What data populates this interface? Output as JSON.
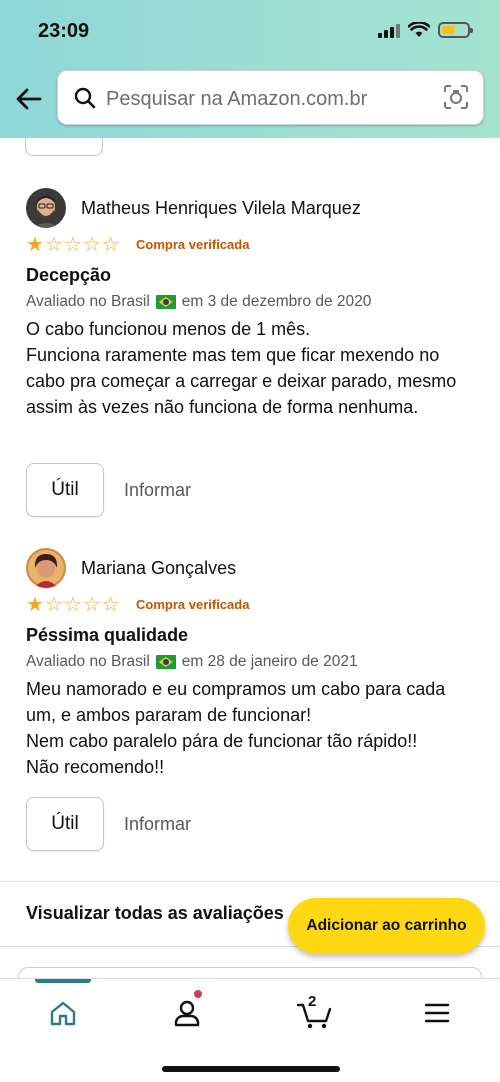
{
  "status": {
    "time": "23:09"
  },
  "search": {
    "placeholder": "Pesquisar na Amazon.com.br"
  },
  "reviews": [
    {
      "author": "Matheus Henriques Vilela Marquez",
      "rating": 1,
      "rating_max": 5,
      "verified": "Compra verificada",
      "title": "Decepção",
      "meta_prefix": "Avaliado no Brasil",
      "meta_date": "em 3 de dezembro de 2020",
      "body": "O cabo funcionou menos de 1 mês.\nFunciona raramente mas tem que ficar mexendo no cabo pra começar a carregar e deixar parado, mesmo assim às vezes não funciona de forma nenhuma.",
      "helpful": "Útil",
      "report": "Informar"
    },
    {
      "author": "Mariana Gonçalves",
      "rating": 1,
      "rating_max": 5,
      "verified": "Compra verificada",
      "title": "Péssima qualidade",
      "meta_prefix": "Avaliado no Brasil",
      "meta_date": "em 28 de janeiro de 2021",
      "body": "Meu namorado e eu compramos um cabo para cada um, e ambos pararam de funcionar!\nNem cabo paralelo pára de funcionar tão rápido!!\nNão recomendo!!",
      "helpful": "Útil",
      "report": "Informar"
    }
  ],
  "view_all": "Visualizar todas as avaliações",
  "add_to_cart": "Adicionar ao carrinho",
  "nav": {
    "cart_count": "2"
  },
  "colors": {
    "accent": "#2b7c86",
    "button": "#ffd814",
    "star": "#f5a623",
    "verified": "#c45500"
  }
}
